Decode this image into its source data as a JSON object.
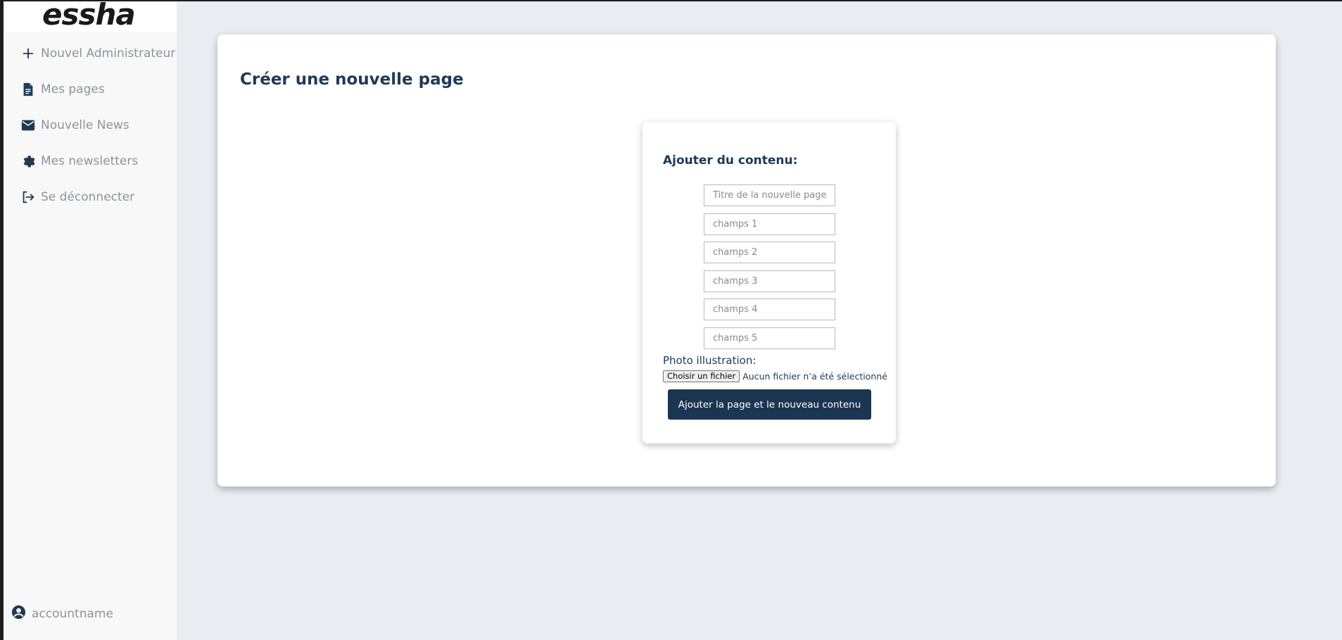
{
  "brand": {
    "logo_text": "essha"
  },
  "sidebar": {
    "items": [
      {
        "label": "Nouvel Administrateur",
        "icon": "plus-icon"
      },
      {
        "label": "Mes pages",
        "icon": "document-icon"
      },
      {
        "label": "Nouvelle News",
        "icon": "envelope-icon"
      },
      {
        "label": "Mes newsletters",
        "icon": "gear-icon"
      },
      {
        "label": "Se déconnecter",
        "icon": "logout-icon"
      }
    ],
    "account": {
      "name": "accountname",
      "icon": "account-circle-icon"
    }
  },
  "main": {
    "title": "Créer une nouvelle page",
    "form": {
      "heading": "Ajouter du contenu:",
      "fields": [
        {
          "placeholder": "Titre de la nouvelle page",
          "value": ""
        },
        {
          "placeholder": "champs 1",
          "value": ""
        },
        {
          "placeholder": "champs 2",
          "value": ""
        },
        {
          "placeholder": "champs 3",
          "value": ""
        },
        {
          "placeholder": "champs 4",
          "value": ""
        },
        {
          "placeholder": "champs 5",
          "value": ""
        }
      ],
      "photo_label": "Photo illustration:",
      "file_button": "Choisir un fichier",
      "file_status": "Aucun fichier n’a été sélectionné",
      "submit_label": "Ajouter la page et le nouveau contenu"
    }
  },
  "colors": {
    "accent": "#1c3551",
    "title": "#1e3a55",
    "sidebar_text": "#8e9399",
    "page_bg": "#e9ecf1",
    "sidebar_bg": "#f8f8f8"
  }
}
